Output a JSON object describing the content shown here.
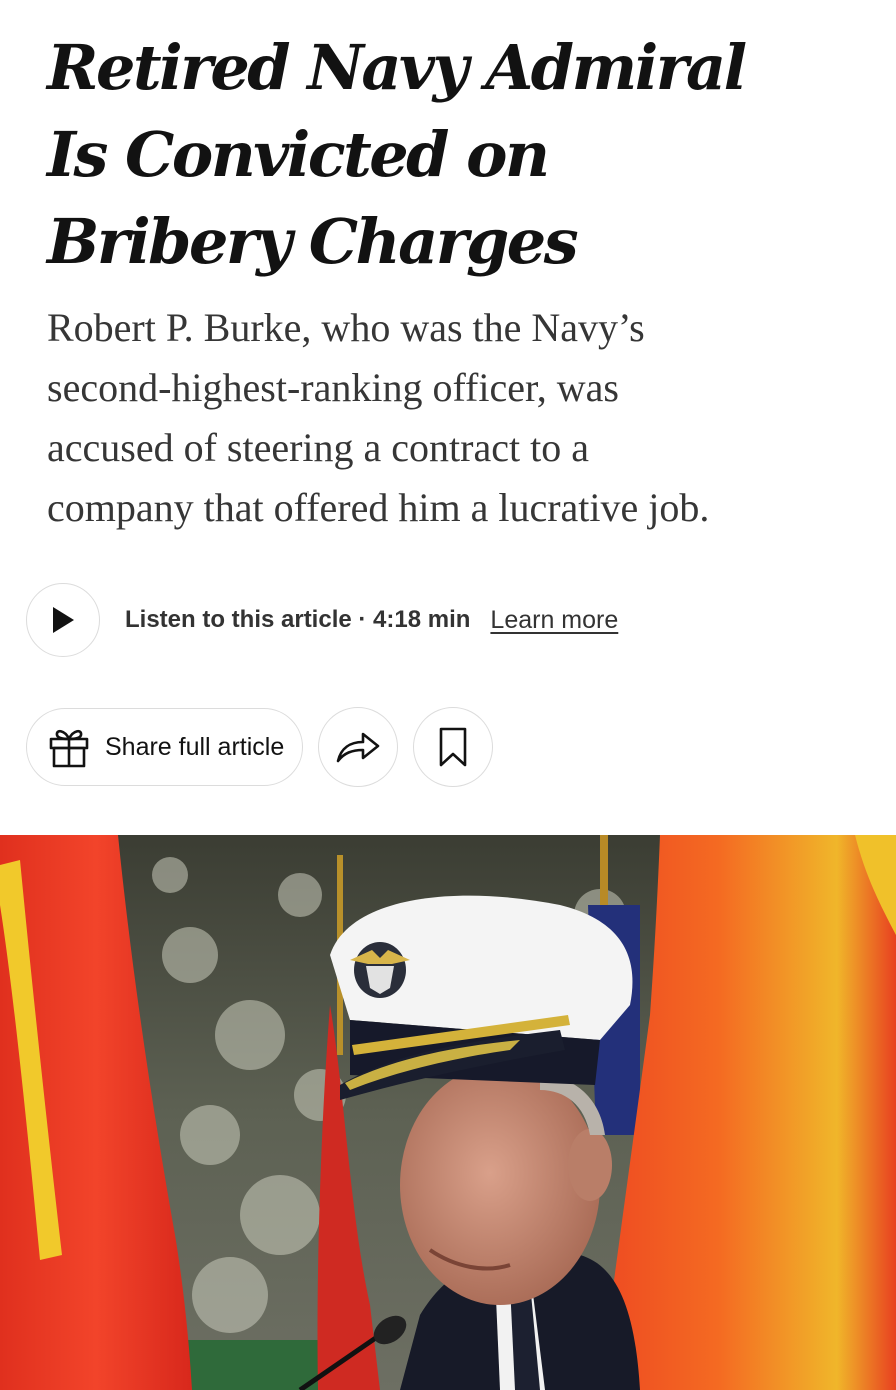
{
  "article": {
    "headline_lines": [
      "Retired Navy Admiral",
      "Is Convicted on",
      "Bribery Charges"
    ],
    "summary_lines": [
      "Robert P. Burke, who was the Navy’s",
      "second-highest-ranking officer, was",
      "accused of steering a contract to a",
      "company that offered him a lucrative job."
    ]
  },
  "audio": {
    "listen_label": "Listen to this article · 4:18 min",
    "learn_more": "Learn more",
    "play_icon": "play-icon"
  },
  "actions": {
    "share_label": "Share full article",
    "gift_icon": "gift-icon",
    "share_icon": "share-arrow-icon",
    "bookmark_icon": "bookmark-icon"
  },
  "photo": {
    "subject": "lead-photo"
  }
}
